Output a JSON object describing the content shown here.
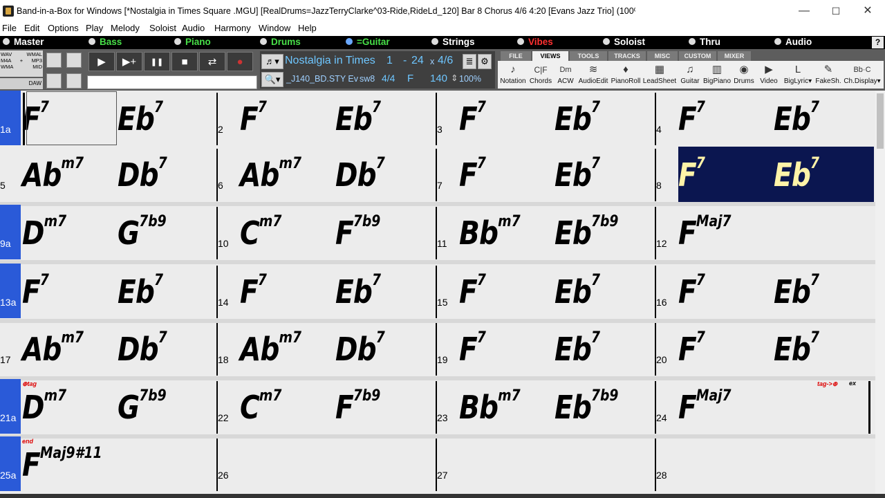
{
  "window": {
    "title": "Band-in-a-Box for Windows  [*Nostalgia in Times Square  .MGU] [RealDrums=JazzTerryClarke^03-Ride,RideLd_120] Bar 8 Chorus 4/6   4:20  [Evans Jazz Trio] (100% Tempo)",
    "minimize": "—",
    "maximize": "☐",
    "close": "✕"
  },
  "menu": [
    "File",
    "Edit",
    "Options",
    "Play",
    "Melody",
    "Soloist",
    "Audio",
    "Harmony",
    "Window",
    "Help"
  ],
  "tracks": [
    {
      "label": "Master",
      "color": "#ffffff"
    },
    {
      "label": "Bass",
      "color": "#48e048"
    },
    {
      "label": "Piano",
      "color": "#48e048"
    },
    {
      "label": "Drums",
      "color": "#48e048"
    },
    {
      "label": "=Guitar",
      "color": "#48e048"
    },
    {
      "label": "Strings",
      "color": "#ffffff"
    },
    {
      "label": "Vibes",
      "color": "#ff3030"
    },
    {
      "label": "Soloist",
      "color": "#ffffff"
    },
    {
      "label": "Thru",
      "color": "#ffffff"
    },
    {
      "label": "Audio",
      "color": "#ffffff"
    }
  ],
  "help_label": "?",
  "format_buttons": {
    "wav": "WAV",
    "wmal": "WMAL",
    "m4a": "M4A",
    "plus": "+",
    "mp3": "MP3",
    "wma": "WMA",
    "mid": "MID",
    "daw": "DAW"
  },
  "transport": {
    "play": "▶",
    "play_from": "▶+",
    "pause": "❚❚",
    "stop": "■",
    "loop": "⇄",
    "record": "●"
  },
  "song": {
    "title": "Nostalgia in Times",
    "start_bar": "1",
    "dash": "-",
    "end_bar": "24",
    "x": "x",
    "choruses": "4/6",
    "style": "_J140_BD.STY Ev",
    "feel": "sw8",
    "time_sig": "4/4",
    "key": "F",
    "tempo": "140",
    "tempo_pct": "100%"
  },
  "view_tabs": [
    "FILE",
    "VIEWS",
    "TOOLS",
    "TRACKS",
    "MISC",
    "CUSTOM",
    "MIXER"
  ],
  "view_buttons": [
    {
      "label": "Notation",
      "icon": "♪"
    },
    {
      "label": "Chords",
      "icon": "C|F"
    },
    {
      "label": "ACW",
      "icon": "Dm"
    },
    {
      "label": "AudioEdit",
      "icon": "≋"
    },
    {
      "label": "PianoRoll",
      "icon": "♦"
    },
    {
      "label": "LeadSheet",
      "icon": "▦"
    },
    {
      "label": "Guitar",
      "icon": "♫"
    },
    {
      "label": "BigPiano",
      "icon": "▥"
    },
    {
      "label": "Drums",
      "icon": "◉"
    },
    {
      "label": "Video",
      "icon": "▶"
    },
    {
      "label": "BigLyric▾",
      "icon": "L"
    },
    {
      "label": "FakeSh.",
      "icon": "✎"
    },
    {
      "label": "Ch.Display▾",
      "icon": "Bb·C"
    }
  ],
  "rows": [
    {
      "bars": [
        {
          "num": "1a",
          "c1": {
            "r": "F",
            "q": "7"
          },
          "c2": {
            "r": "Eb",
            "q": "7"
          }
        },
        {
          "num": "2",
          "c1": {
            "r": "F",
            "q": "7"
          },
          "c2": {
            "r": "Eb",
            "q": "7"
          }
        },
        {
          "num": "3",
          "c1": {
            "r": "F",
            "q": "7"
          },
          "c2": {
            "r": "Eb",
            "q": "7"
          }
        },
        {
          "num": "4",
          "c1": {
            "r": "F",
            "q": "7"
          },
          "c2": {
            "r": "Eb",
            "q": "7"
          }
        }
      ]
    },
    {
      "bars": [
        {
          "num": "5",
          "c1": {
            "r": "Ab",
            "q": "m7"
          },
          "c2": {
            "r": "Db",
            "q": "7"
          }
        },
        {
          "num": "6",
          "c1": {
            "r": "Ab",
            "q": "m7"
          },
          "c2": {
            "r": "Db",
            "q": "7"
          }
        },
        {
          "num": "7",
          "c1": {
            "r": "F",
            "q": "7"
          },
          "c2": {
            "r": "Eb",
            "q": "7"
          }
        },
        {
          "num": "8",
          "c1": {
            "r": "F",
            "q": "7"
          },
          "c2": {
            "r": "Eb",
            "q": "7"
          }
        }
      ]
    },
    {
      "bars": [
        {
          "num": "9a",
          "c1": {
            "r": "D",
            "q": "m7"
          },
          "c2": {
            "r": "G",
            "q": "7b9"
          }
        },
        {
          "num": "10",
          "c1": {
            "r": "C",
            "q": "m7"
          },
          "c2": {
            "r": "F",
            "q": "7b9"
          }
        },
        {
          "num": "11",
          "c1": {
            "r": "Bb",
            "q": "m7"
          },
          "c2": {
            "r": "Eb",
            "q": "7b9"
          }
        },
        {
          "num": "12",
          "c1": {
            "r": "F",
            "q": "Maj7"
          },
          "c2": {
            "r": "",
            "q": ""
          }
        }
      ]
    },
    {
      "bars": [
        {
          "num": "13a",
          "c1": {
            "r": "F",
            "q": "7"
          },
          "c2": {
            "r": "Eb",
            "q": "7"
          }
        },
        {
          "num": "14",
          "c1": {
            "r": "F",
            "q": "7"
          },
          "c2": {
            "r": "Eb",
            "q": "7"
          }
        },
        {
          "num": "15",
          "c1": {
            "r": "F",
            "q": "7"
          },
          "c2": {
            "r": "Eb",
            "q": "7"
          }
        },
        {
          "num": "16",
          "c1": {
            "r": "F",
            "q": "7"
          },
          "c2": {
            "r": "Eb",
            "q": "7"
          }
        }
      ]
    },
    {
      "bars": [
        {
          "num": "17",
          "c1": {
            "r": "Ab",
            "q": "m7"
          },
          "c2": {
            "r": "Db",
            "q": "7"
          }
        },
        {
          "num": "18",
          "c1": {
            "r": "Ab",
            "q": "m7"
          },
          "c2": {
            "r": "Db",
            "q": "7"
          }
        },
        {
          "num": "19",
          "c1": {
            "r": "F",
            "q": "7"
          },
          "c2": {
            "r": "Eb",
            "q": "7"
          }
        },
        {
          "num": "20",
          "c1": {
            "r": "F",
            "q": "7"
          },
          "c2": {
            "r": "Eb",
            "q": "7"
          }
        }
      ]
    },
    {
      "bars": [
        {
          "num": "21a",
          "c1": {
            "r": "D",
            "q": "m7"
          },
          "c2": {
            "r": "G",
            "q": "7b9"
          }
        },
        {
          "num": "22",
          "c1": {
            "r": "C",
            "q": "m7"
          },
          "c2": {
            "r": "F",
            "q": "7b9"
          }
        },
        {
          "num": "23",
          "c1": {
            "r": "Bb",
            "q": "m7"
          },
          "c2": {
            "r": "Eb",
            "q": "7b9"
          }
        },
        {
          "num": "24",
          "c1": {
            "r": "F",
            "q": "Maj7"
          },
          "c2": {
            "r": "",
            "q": ""
          }
        }
      ]
    },
    {
      "bars": [
        {
          "num": "25a",
          "c1": {
            "r": "F",
            "q": "Maj9#11"
          },
          "c2": {
            "r": "",
            "q": ""
          }
        },
        {
          "num": "26",
          "c1": {
            "r": "",
            "q": ""
          },
          "c2": {
            "r": "",
            "q": ""
          }
        },
        {
          "num": "27",
          "c1": {
            "r": "",
            "q": ""
          },
          "c2": {
            "r": "",
            "q": ""
          }
        },
        {
          "num": "28",
          "c1": {
            "r": "",
            "q": ""
          },
          "c2": {
            "r": "",
            "q": ""
          }
        }
      ]
    }
  ],
  "markers": {
    "tag": "⊕tag",
    "tag_jump": "tag->⊕",
    "ex": "ex",
    "end": "end"
  }
}
